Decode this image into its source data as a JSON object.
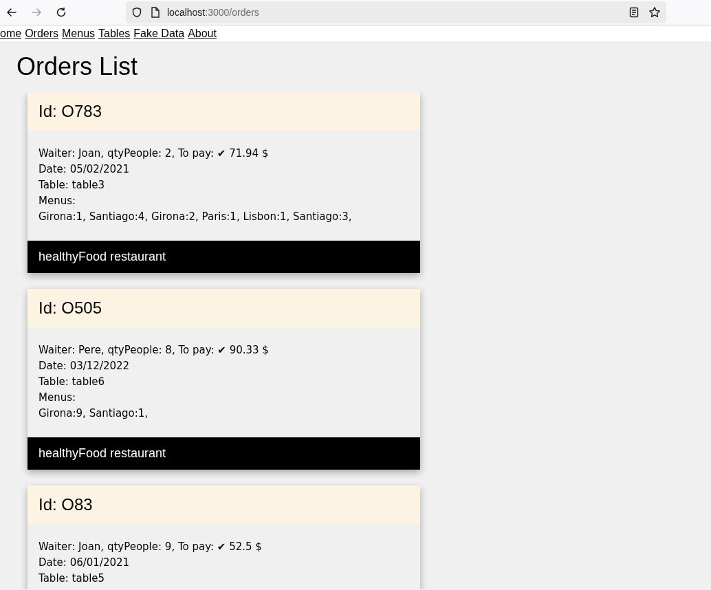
{
  "browser": {
    "url_host": "localhost",
    "url_path": ":3000/orders",
    "back_disabled": false,
    "forward_disabled": true
  },
  "nav_links": [
    "ome",
    "Orders",
    "Menus",
    "Tables",
    "Fake Data",
    "About"
  ],
  "page_title": "Orders List",
  "orders": [
    {
      "id": "Id: O783",
      "lines": [
        "Waiter: Joan, qtyPeople: 2, To pay: ✔ 71.94 $",
        "Date: 05/02/2021",
        "Table: table3",
        "Menus:",
        "Girona:1, Santiago:4, Girona:2, Paris:1, Lisbon:1, Santiago:3,"
      ],
      "footer": "healthyFood restaurant"
    },
    {
      "id": "Id: O505",
      "lines": [
        "Waiter: Pere, qtyPeople: 8, To pay: ✔ 90.33 $",
        "Date: 03/12/2022",
        "Table: table6",
        "Menus:",
        "Girona:9, Santiago:1,"
      ],
      "footer": "healthyFood restaurant"
    },
    {
      "id": "Id: O83",
      "lines": [
        "Waiter: Joan, qtyPeople: 9, To pay: ✔ 52.5 $",
        "Date: 06/01/2021",
        "Table: table5"
      ]
    }
  ]
}
